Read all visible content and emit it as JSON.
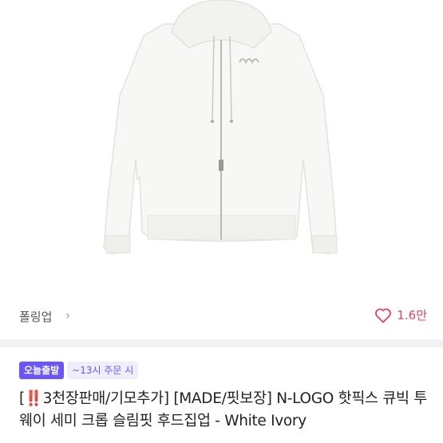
{
  "product": {
    "image_alt": "product-photo",
    "brand": "폴링업",
    "brand_chevron": "›",
    "likes": "1.6만",
    "badges": {
      "today": "오늘출발",
      "deadline": "~13시 주문 시"
    },
    "title_open": "[",
    "title_excl": "‼️",
    "title_rest": "3천장판매/기모추가] [MADE/핏보장] N-LOGO 핫픽스 큐빅 투웨이 세미 크롭 슬림핏 후드집업 - White Ivory"
  },
  "colors": {
    "accent": "#6a55ff",
    "like": "#e4435f"
  }
}
